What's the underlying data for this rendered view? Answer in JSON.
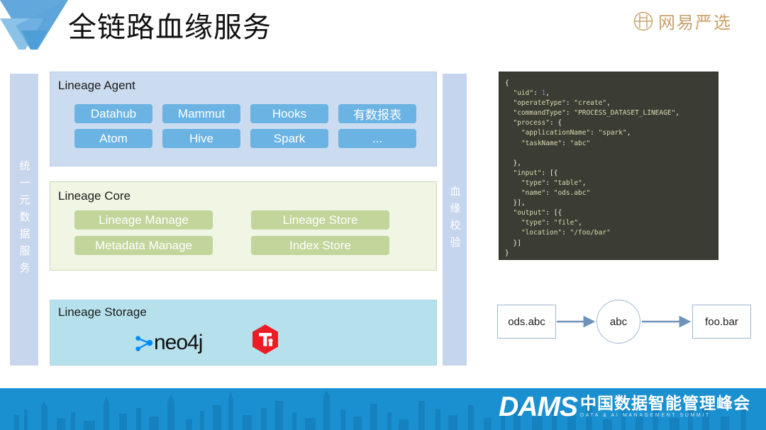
{
  "header": {
    "title": "全链路血缘服务",
    "logo_icon": "triangle-w-logo",
    "brand_text": "网易严选",
    "brand_icon": "circle-grid-icon",
    "brand_color": "#c8a06a"
  },
  "left_rail": {
    "label": "统一元数据服务"
  },
  "right_rail": {
    "label": "血缘校验"
  },
  "panels": [
    {
      "title": "Lineage Agent",
      "accent": "#6bb3e3",
      "background": "#ccdcf0",
      "tags": [
        "Datahub",
        "Mammut",
        "Hooks",
        "有数报表",
        "Atom",
        "Hive",
        "Spark",
        "..."
      ]
    },
    {
      "title": "Lineage Core",
      "accent": "#c2d59b",
      "background": "#f1f5e3",
      "tags": [
        "Lineage Manage",
        "Lineage Store",
        "Metadata Manage",
        "Index Store"
      ]
    },
    {
      "title": "Lineage Storage",
      "accent": "#b6e1ec",
      "background": "#b6e1ec",
      "logos": [
        {
          "name": "neo4j-logo",
          "text": "neo4j",
          "color": "#018bff"
        },
        {
          "name": "tidb-logo",
          "text": "Ti",
          "color": "#ed1c24"
        }
      ]
    }
  ],
  "code_block": {
    "language": "json",
    "background": "#3b3d34",
    "key_color": "#d9d9ae",
    "number_color": "#9a7ad6",
    "lines": [
      "{",
      "  \"uid\": 1,",
      "  \"operateType\": \"create\",",
      "  \"commandType\": \"PROCESS_DATASET_LINEAGE\",",
      "  \"process\": {",
      "    \"applicationName\": \"spark\",",
      "    \"taskName\": \"abc\"",
      "",
      "  },",
      "  \"input\": [{",
      "    \"type\": \"table\",",
      "    \"name\": \"ods.abc\"",
      "  }],",
      "  \"output\": [{",
      "    \"type\": \"file\",",
      "    \"location\": \"/foo/bar\"",
      "  }]",
      "}"
    ]
  },
  "lineage_flow": {
    "source": "ods.abc",
    "process": "abc",
    "target": "foo.bar",
    "arrow_color": "#6f92b8"
  },
  "footer": {
    "dams": "DAMS",
    "title_cn": "中国数据智能管理峰会",
    "title_en": "DATA & AI MANAGEMENT SUMMIT",
    "background": "#1b90d0"
  }
}
